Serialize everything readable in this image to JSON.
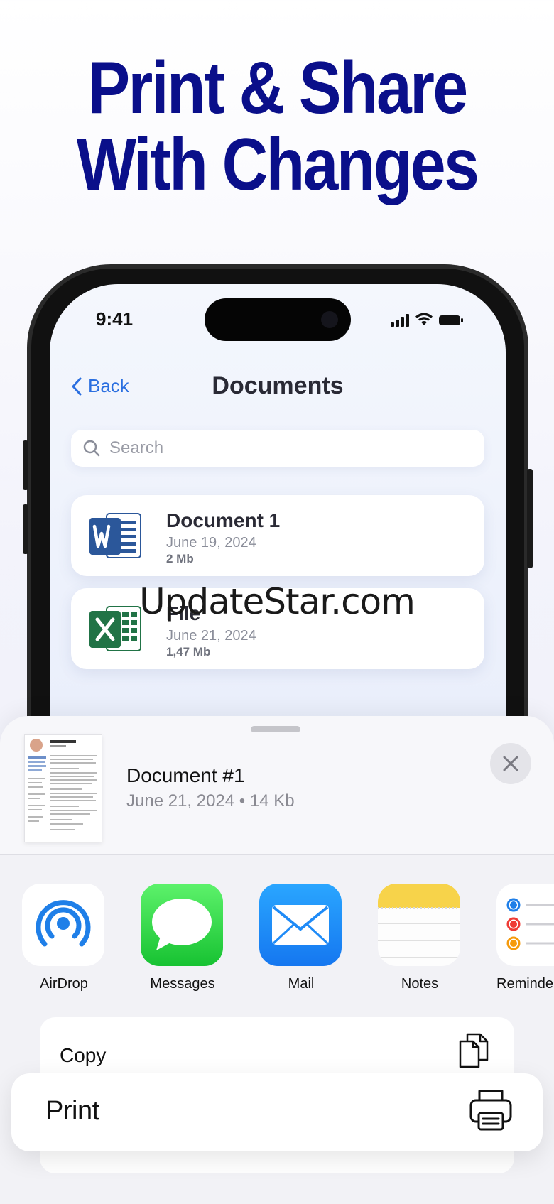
{
  "headline": {
    "line1": "Print & Share",
    "line2": "With Changes"
  },
  "status_bar": {
    "time": "9:41"
  },
  "nav": {
    "back_label": "Back",
    "title": "Documents"
  },
  "search": {
    "placeholder": "Search"
  },
  "documents": [
    {
      "name": "Document 1",
      "date": "June 19, 2024",
      "size": "2 Mb",
      "icon": "word-icon"
    },
    {
      "name": "File",
      "date": "June 21, 2024",
      "size": "1,47 Mb",
      "icon": "excel-icon"
    }
  ],
  "watermark": "UpdateStar.com",
  "share_sheet": {
    "document_title": "Document #1",
    "document_meta": "June 21, 2024 • 14 Kb",
    "apps": [
      {
        "label": "AirDrop",
        "icon": "airdrop-icon"
      },
      {
        "label": "Messages",
        "icon": "messages-icon"
      },
      {
        "label": "Mail",
        "icon": "mail-icon"
      },
      {
        "label": "Notes",
        "icon": "notes-icon"
      },
      {
        "label": "Reminde",
        "icon": "reminders-icon"
      }
    ],
    "actions": {
      "copy": "Copy",
      "print": "Print"
    }
  },
  "colors": {
    "headline": "#0a0f8a",
    "accent": "#2b6fe0",
    "word": "#2b579a",
    "excel": "#217346"
  }
}
